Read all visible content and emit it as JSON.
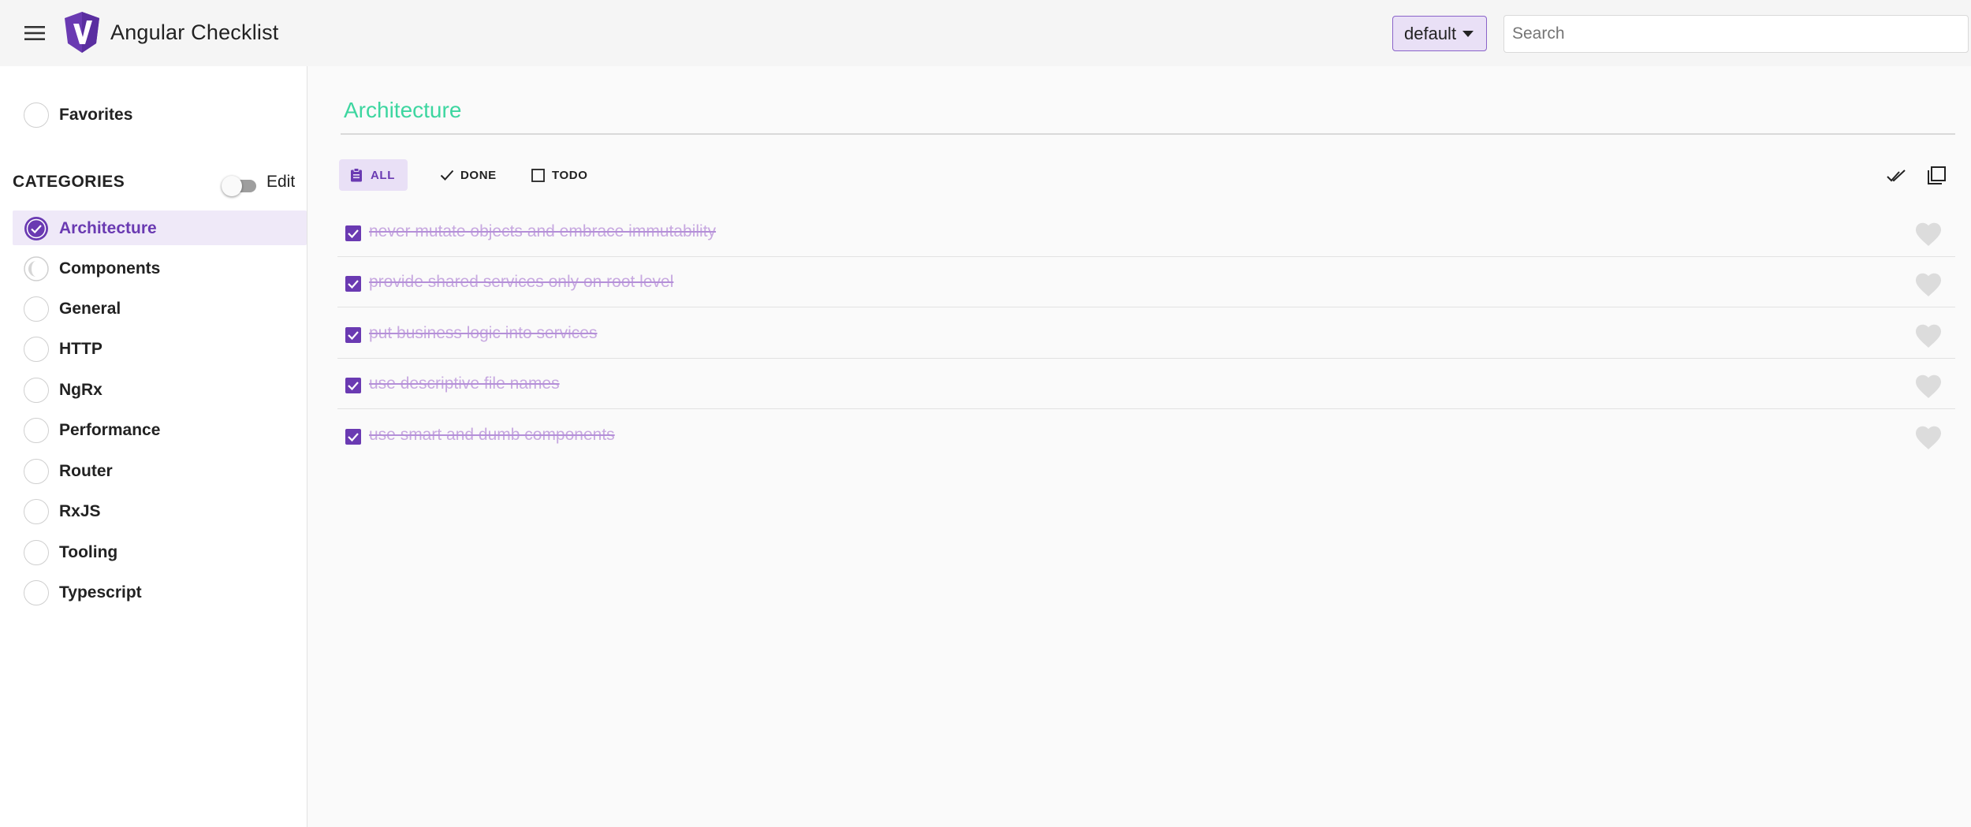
{
  "header": {
    "title": "Angular Checklist",
    "profile": "default",
    "search_placeholder": "Search"
  },
  "sidebar": {
    "favorites_label": "Favorites",
    "categories_header": "CATEGORIES",
    "edit_label": "Edit",
    "edit_mode_enabled": false,
    "categories": [
      {
        "label": "Architecture",
        "progress": 1.0,
        "active": true
      },
      {
        "label": "Components",
        "progress": 0.1,
        "active": false
      },
      {
        "label": "General",
        "progress": 0,
        "active": false
      },
      {
        "label": "HTTP",
        "progress": 0,
        "active": false
      },
      {
        "label": "NgRx",
        "progress": 0,
        "active": false
      },
      {
        "label": "Performance",
        "progress": 0,
        "active": false
      },
      {
        "label": "Router",
        "progress": 0,
        "active": false
      },
      {
        "label": "RxJS",
        "progress": 0,
        "active": false
      },
      {
        "label": "Tooling",
        "progress": 0,
        "active": false
      },
      {
        "label": "Typescript",
        "progress": 0,
        "active": false
      }
    ]
  },
  "main": {
    "title": "Architecture",
    "filters": [
      {
        "label": "ALL",
        "icon": "clipboard-icon",
        "active": true
      },
      {
        "label": "DONE",
        "icon": "check-icon",
        "active": false
      },
      {
        "label": "TODO",
        "icon": "square-icon",
        "active": false
      }
    ],
    "toolbar_icons": [
      "double-check-icon",
      "collapse-icon"
    ],
    "items": [
      {
        "text": "never mutate objects and embrace immutability",
        "done": true
      },
      {
        "text": "provide shared services only on root level",
        "done": true
      },
      {
        "text": "put business logic into services",
        "done": true
      },
      {
        "text": "use descriptive file names",
        "done": true
      },
      {
        "text": "use smart and dumb components",
        "done": true
      }
    ]
  },
  "colors": {
    "accent": "#6a3ab2",
    "accent_light": "#e9e0f6",
    "title_green": "#3dd6a0",
    "done_text": "#c7a8e0"
  }
}
